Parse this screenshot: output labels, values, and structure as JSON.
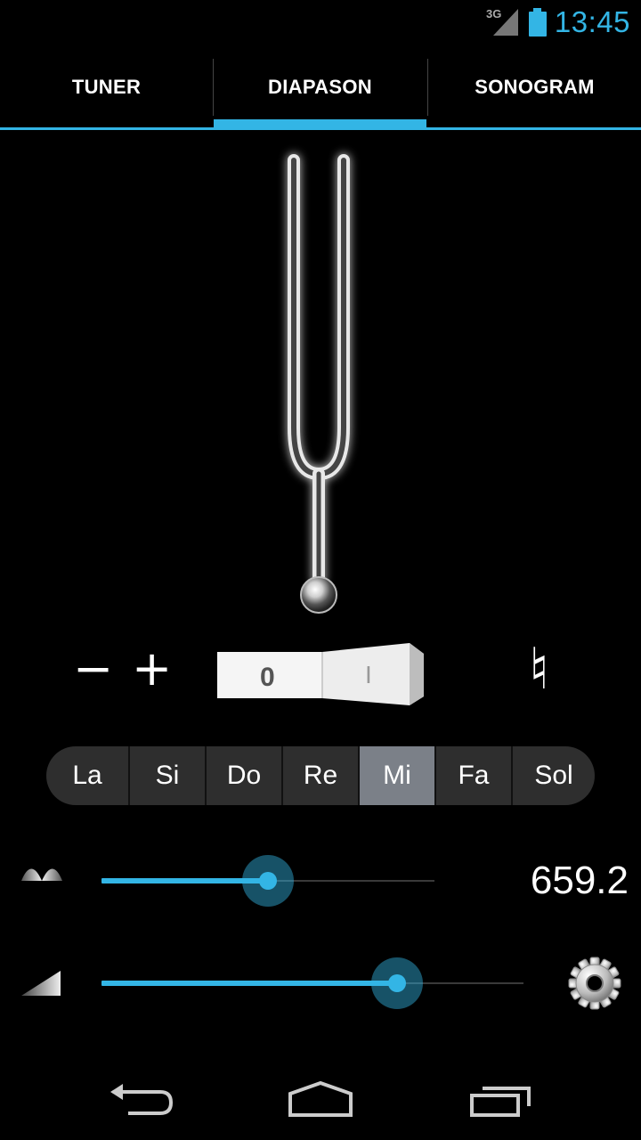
{
  "status_bar": {
    "network_label": "3G",
    "time": "13:45",
    "accent_color": "#33b5e5"
  },
  "tabs": [
    {
      "label": "TUNER",
      "selected": false
    },
    {
      "label": "DIAPASON",
      "selected": true
    },
    {
      "label": "SONOGRAM",
      "selected": false
    }
  ],
  "controls": {
    "minus_label": "−",
    "plus_label": "+",
    "switch_off_label": "0",
    "switch_on_label": "I",
    "accidental_symbol": "♮"
  },
  "notes": {
    "items": [
      "La",
      "Si",
      "Do",
      "Re",
      "Mi",
      "Fa",
      "Sol"
    ],
    "selected": "Mi"
  },
  "frequency_slider": {
    "value_fraction": 0.5,
    "frequency_value": "659.2",
    "icon": "sine-wave-icon"
  },
  "volume_slider": {
    "value_fraction": 0.7,
    "icon": "volume-ramp-icon"
  },
  "settings": {
    "icon": "gear-icon"
  },
  "nav": {
    "back": "back-icon",
    "home": "home-icon",
    "recents": "recents-icon"
  }
}
